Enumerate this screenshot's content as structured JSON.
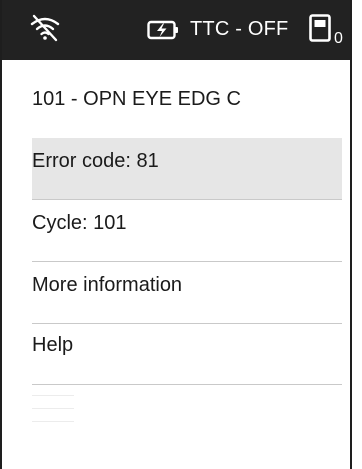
{
  "status_bar": {
    "wifi_icon": "wifi-off-icon",
    "battery_icon": "battery-charging-icon",
    "ttc_label": "TTC - OFF",
    "device_icon": "device-icon",
    "device_count": "0"
  },
  "screen": {
    "title": "101 - OPN EYE EDG C",
    "items": [
      {
        "label": "Error code: 81",
        "selected": true
      },
      {
        "label": "Cycle: 101",
        "selected": false
      },
      {
        "label": "More information",
        "selected": false
      },
      {
        "label": "Help",
        "selected": false
      }
    ]
  },
  "colors": {
    "status_bar_bg": "#222222",
    "selected_row_bg": "#e6e6e6",
    "divider": "#c9c9c9"
  }
}
